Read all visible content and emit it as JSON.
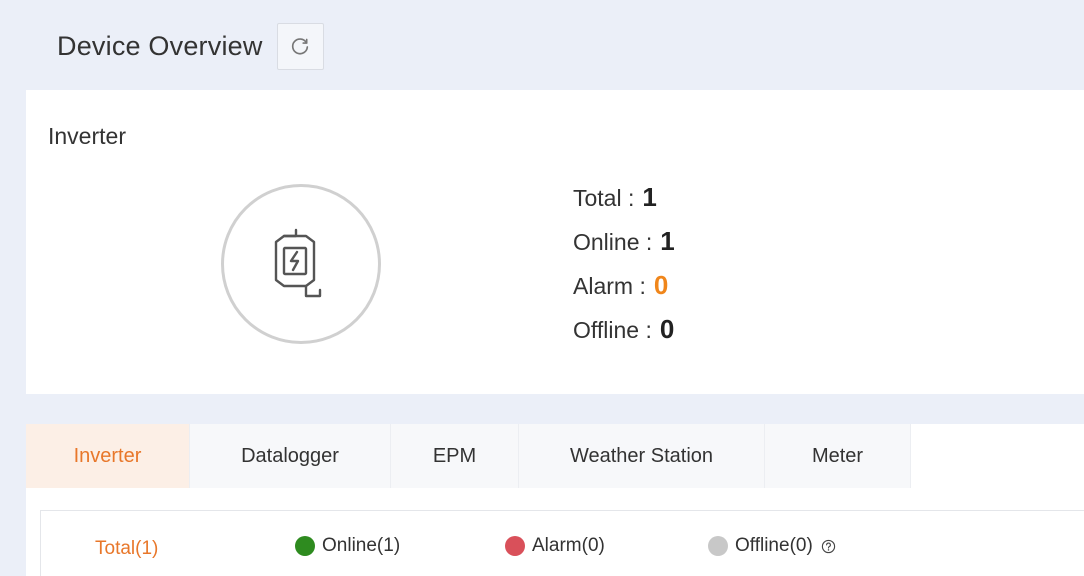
{
  "header": {
    "title": "Device Overview"
  },
  "card": {
    "title": "Inverter",
    "stats": [
      {
        "label": "Total :",
        "value": "1"
      },
      {
        "label": "Online :",
        "value": "1"
      },
      {
        "label": "Alarm :",
        "value": "0"
      },
      {
        "label": "Offline :",
        "value": "0"
      }
    ]
  },
  "tabs": [
    {
      "label": "Inverter",
      "active": true
    },
    {
      "label": "Datalogger"
    },
    {
      "label": "EPM"
    },
    {
      "label": "Weather Station"
    },
    {
      "label": "Meter"
    }
  ],
  "filters": {
    "total": "Total(1)",
    "online": "Online(1)",
    "alarm": "Alarm(0)",
    "offline": "Offline(0)"
  },
  "colors": {
    "accent": "#e8772a",
    "alarm_value": "#f0861b",
    "online": "#2e8b1f",
    "alarm": "#d9505a",
    "offline": "#c8c8c8"
  },
  "icons": [
    "refresh-icon",
    "inverter-icon",
    "help-icon"
  ]
}
